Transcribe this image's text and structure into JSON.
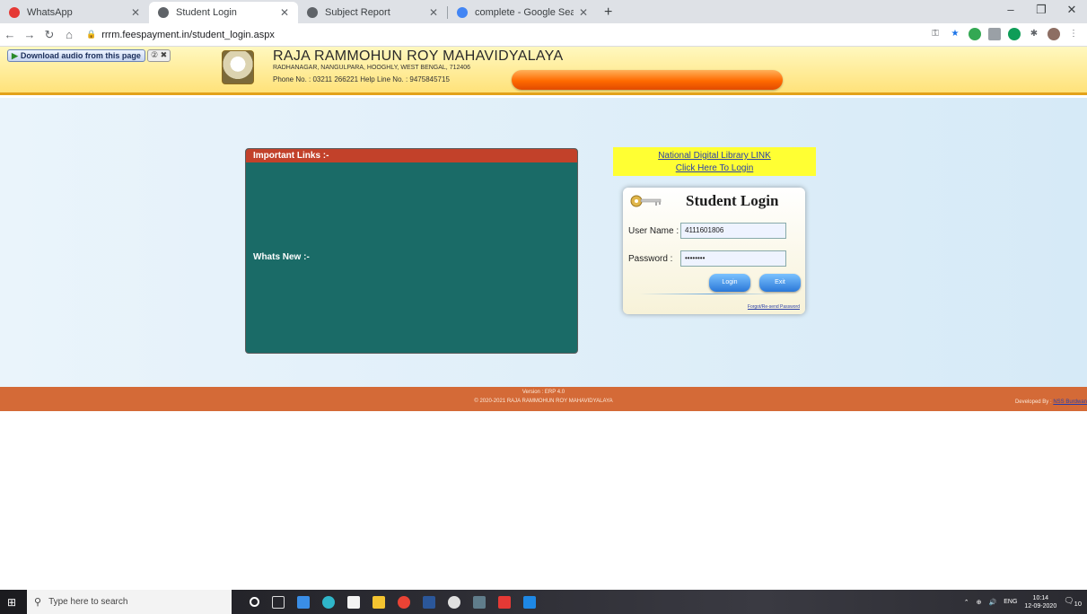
{
  "browser": {
    "tabs": [
      {
        "label": "WhatsApp",
        "favicon_color": "#e53935",
        "active": false
      },
      {
        "label": "Student Login",
        "favicon_color": "#5f6368",
        "active": true
      },
      {
        "label": "Subject Report",
        "favicon_color": "#5f6368",
        "active": false
      },
      {
        "label": "complete - Google Search",
        "favicon_color": "#4285f4",
        "active": false
      }
    ],
    "new_tab": "+",
    "url": "rrrm.feespayment.in/student_login.aspx"
  },
  "header": {
    "download_audio": "Download audio from this page",
    "download_extra": "② ✖",
    "college_name": "RAJA RAMMOHUN ROY MAHAVIDYALAYA",
    "address": "RADHANAGAR, NANGULPARA, HOOGHLY, WEST BENGAL, 712406",
    "phone": "Phone No. : 03211 266221   Help Line No. : 9475845715"
  },
  "links_panel": {
    "title": "Important Links :-",
    "whats_new": "Whats New :-"
  },
  "ndl": {
    "link1": "National Digital Library LINK",
    "link2": "Click Here To Login"
  },
  "login": {
    "title": "Student Login",
    "username_label": "User Name :",
    "username_value": "4111601806",
    "password_label": "Password :",
    "password_value": "••••••••",
    "login_button": "Login",
    "exit_button": "Exit",
    "forgot_link": "Forgot/Re-send Password"
  },
  "footer": {
    "version": "Version : ERP 4.0",
    "copyright": "© 2020-2021   RAJA RAMMOHUN ROY MAHAVIDYALAYA",
    "developed_by": "Developed By : ",
    "developer_link": "NSS Burdwan"
  },
  "taskbar": {
    "search_placeholder": "Type here to search",
    "language": "ENG",
    "time": "10:14",
    "date": "12-09-2020",
    "notification_count": "10"
  },
  "colors": {
    "footer_bg": "#d46a37",
    "links_panel_bg": "#1a6b67",
    "links_header_bg": "#c2412a",
    "ndl_bg": "#ffff33"
  }
}
